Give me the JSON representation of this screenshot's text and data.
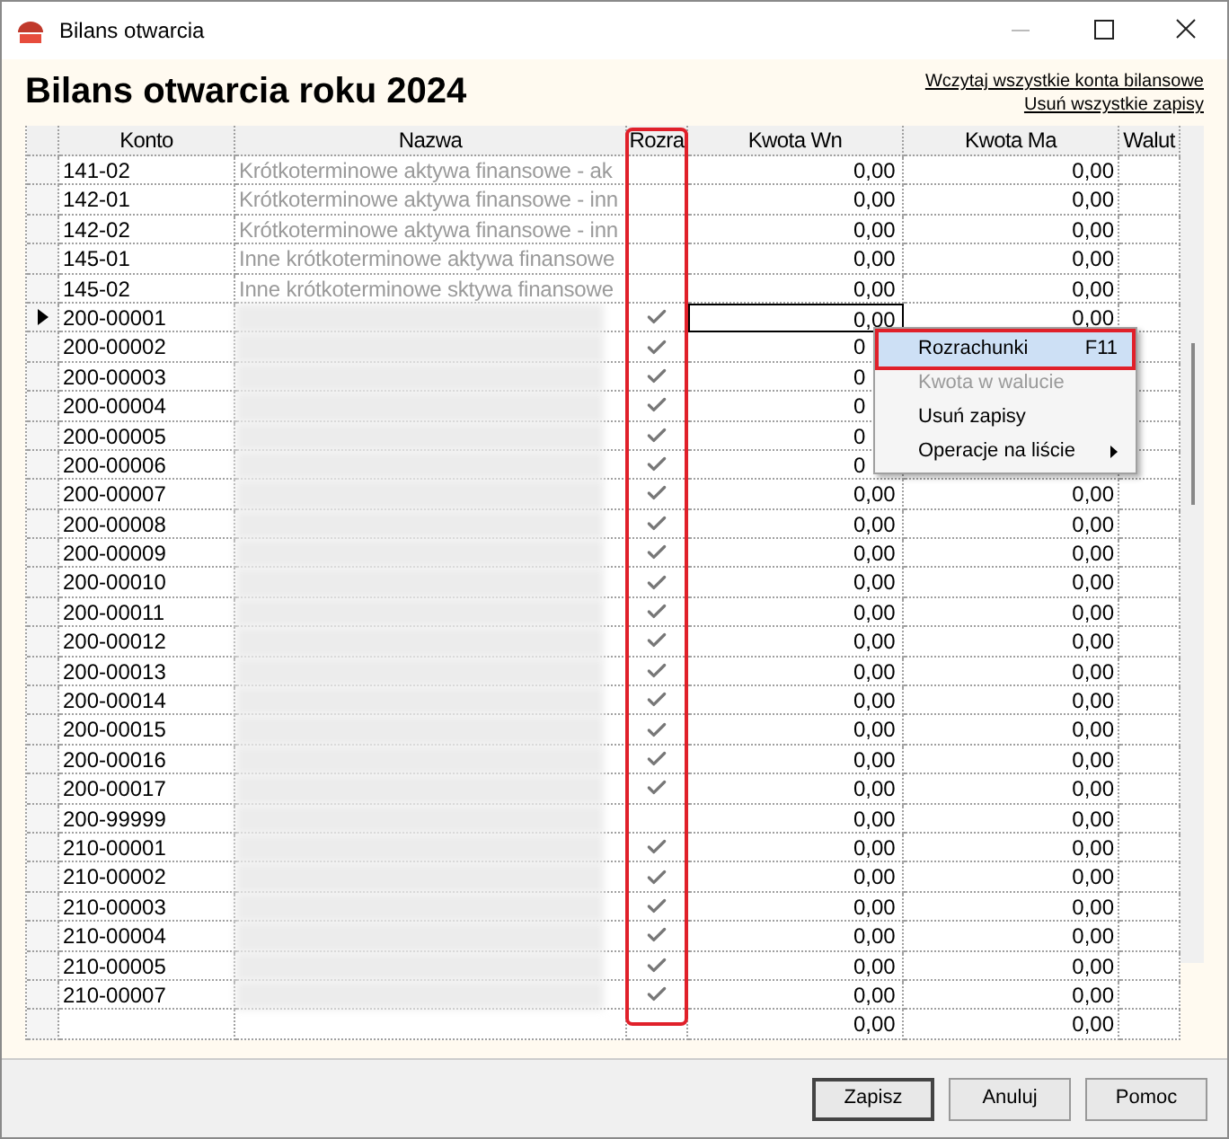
{
  "window": {
    "title": "Bilans otwarcia"
  },
  "heading": "Bilans otwarcia roku 2024",
  "links": [
    "Wczytaj wszystkie konta bilansowe",
    "Usuń wszystkie zapisy"
  ],
  "table": {
    "columns": [
      "Konto",
      "Nazwa",
      "Rozra",
      "Kwota Wn",
      "Kwota Ma",
      "Walut"
    ],
    "rows": [
      {
        "konto": "141-02",
        "nazwa": "Krótkoterminowe aktywa finansowe - ak",
        "redacted": false,
        "checked": false,
        "wn": "0,00",
        "ma": "0,00",
        "selected": false
      },
      {
        "konto": "142-01",
        "nazwa": "Krótkoterminowe aktywa finansowe - inn",
        "redacted": false,
        "checked": false,
        "wn": "0,00",
        "ma": "0,00",
        "selected": false
      },
      {
        "konto": "142-02",
        "nazwa": "Krótkoterminowe aktywa finansowe - inn",
        "redacted": false,
        "checked": false,
        "wn": "0,00",
        "ma": "0,00",
        "selected": false
      },
      {
        "konto": "145-01",
        "nazwa": "Inne krótkoterminowe aktywa finansowe",
        "redacted": false,
        "checked": false,
        "wn": "0,00",
        "ma": "0,00",
        "selected": false
      },
      {
        "konto": "145-02",
        "nazwa": "Inne krótkoterminowe sktywa finansowe",
        "redacted": false,
        "checked": false,
        "wn": "0,00",
        "ma": "0,00",
        "selected": false
      },
      {
        "konto": "200-00001",
        "redacted": true,
        "checked": true,
        "wn": "0,00",
        "ma": "0,00",
        "selected": true
      },
      {
        "konto": "200-00002",
        "redacted": true,
        "checked": true,
        "wn": "0",
        "selected": false
      },
      {
        "konto": "200-00003",
        "redacted": true,
        "checked": true,
        "wn": "0",
        "selected": false
      },
      {
        "konto": "200-00004",
        "redacted": true,
        "checked": true,
        "wn": "0",
        "selected": false
      },
      {
        "konto": "200-00005",
        "redacted": true,
        "checked": true,
        "wn": "0",
        "selected": false
      },
      {
        "konto": "200-00006",
        "redacted": true,
        "checked": true,
        "wn": "0",
        "selected": false
      },
      {
        "konto": "200-00007",
        "redacted": true,
        "checked": true,
        "wn": "0,00",
        "ma": "0,00",
        "selected": false
      },
      {
        "konto": "200-00008",
        "redacted": true,
        "checked": true,
        "wn": "0,00",
        "ma": "0,00",
        "selected": false
      },
      {
        "konto": "200-00009",
        "redacted": true,
        "checked": true,
        "wn": "0,00",
        "ma": "0,00",
        "selected": false
      },
      {
        "konto": "200-00010",
        "redacted": true,
        "checked": true,
        "wn": "0,00",
        "ma": "0,00",
        "selected": false
      },
      {
        "konto": "200-00011",
        "redacted": true,
        "checked": true,
        "wn": "0,00",
        "ma": "0,00",
        "selected": false
      },
      {
        "konto": "200-00012",
        "redacted": true,
        "checked": true,
        "wn": "0,00",
        "ma": "0,00",
        "selected": false
      },
      {
        "konto": "200-00013",
        "redacted": true,
        "checked": true,
        "wn": "0,00",
        "ma": "0,00",
        "selected": false
      },
      {
        "konto": "200-00014",
        "redacted": true,
        "checked": true,
        "wn": "0,00",
        "ma": "0,00",
        "selected": false
      },
      {
        "konto": "200-00015",
        "redacted": true,
        "checked": true,
        "wn": "0,00",
        "ma": "0,00",
        "selected": false
      },
      {
        "konto": "200-00016",
        "redacted": true,
        "checked": true,
        "wn": "0,00",
        "ma": "0,00",
        "selected": false
      },
      {
        "konto": "200-00017",
        "redacted": true,
        "checked": true,
        "wn": "0,00",
        "ma": "0,00",
        "selected": false
      },
      {
        "konto": "200-99999",
        "redacted": true,
        "checked": false,
        "wn": "0,00",
        "ma": "0,00",
        "selected": false
      },
      {
        "konto": "210-00001",
        "redacted": true,
        "checked": true,
        "wn": "0,00",
        "ma": "0,00",
        "selected": false
      },
      {
        "konto": "210-00002",
        "redacted": true,
        "checked": true,
        "wn": "0,00",
        "ma": "0,00",
        "selected": false
      },
      {
        "konto": "210-00003",
        "redacted": true,
        "checked": true,
        "wn": "0,00",
        "ma": "0,00",
        "selected": false
      },
      {
        "konto": "210-00004",
        "redacted": true,
        "checked": true,
        "wn": "0,00",
        "ma": "0,00",
        "selected": false
      },
      {
        "konto": "210-00005",
        "redacted": true,
        "checked": true,
        "wn": "0,00",
        "ma": "0,00",
        "selected": false
      },
      {
        "konto": "210-00007",
        "redacted": true,
        "checked": true,
        "wn": "0,00",
        "ma": "0,00",
        "selected": false
      },
      {
        "redacted": false,
        "checked": false,
        "wn": "0,00",
        "ma": "0,00",
        "selected": false
      }
    ]
  },
  "context_menu": {
    "items": [
      {
        "label": "Rozrachunki",
        "shortcut": "F11",
        "selected": true,
        "disabled": false,
        "submenu": false
      },
      {
        "label": "Kwota w walucie",
        "selected": false,
        "disabled": true,
        "submenu": false
      },
      {
        "label": "Usuń zapisy",
        "selected": false,
        "disabled": false,
        "submenu": false
      },
      {
        "label": "Operacje na liście",
        "selected": false,
        "disabled": false,
        "submenu": true
      }
    ]
  },
  "buttons": [
    "Zapisz",
    "Anuluj",
    "Pomoc"
  ]
}
